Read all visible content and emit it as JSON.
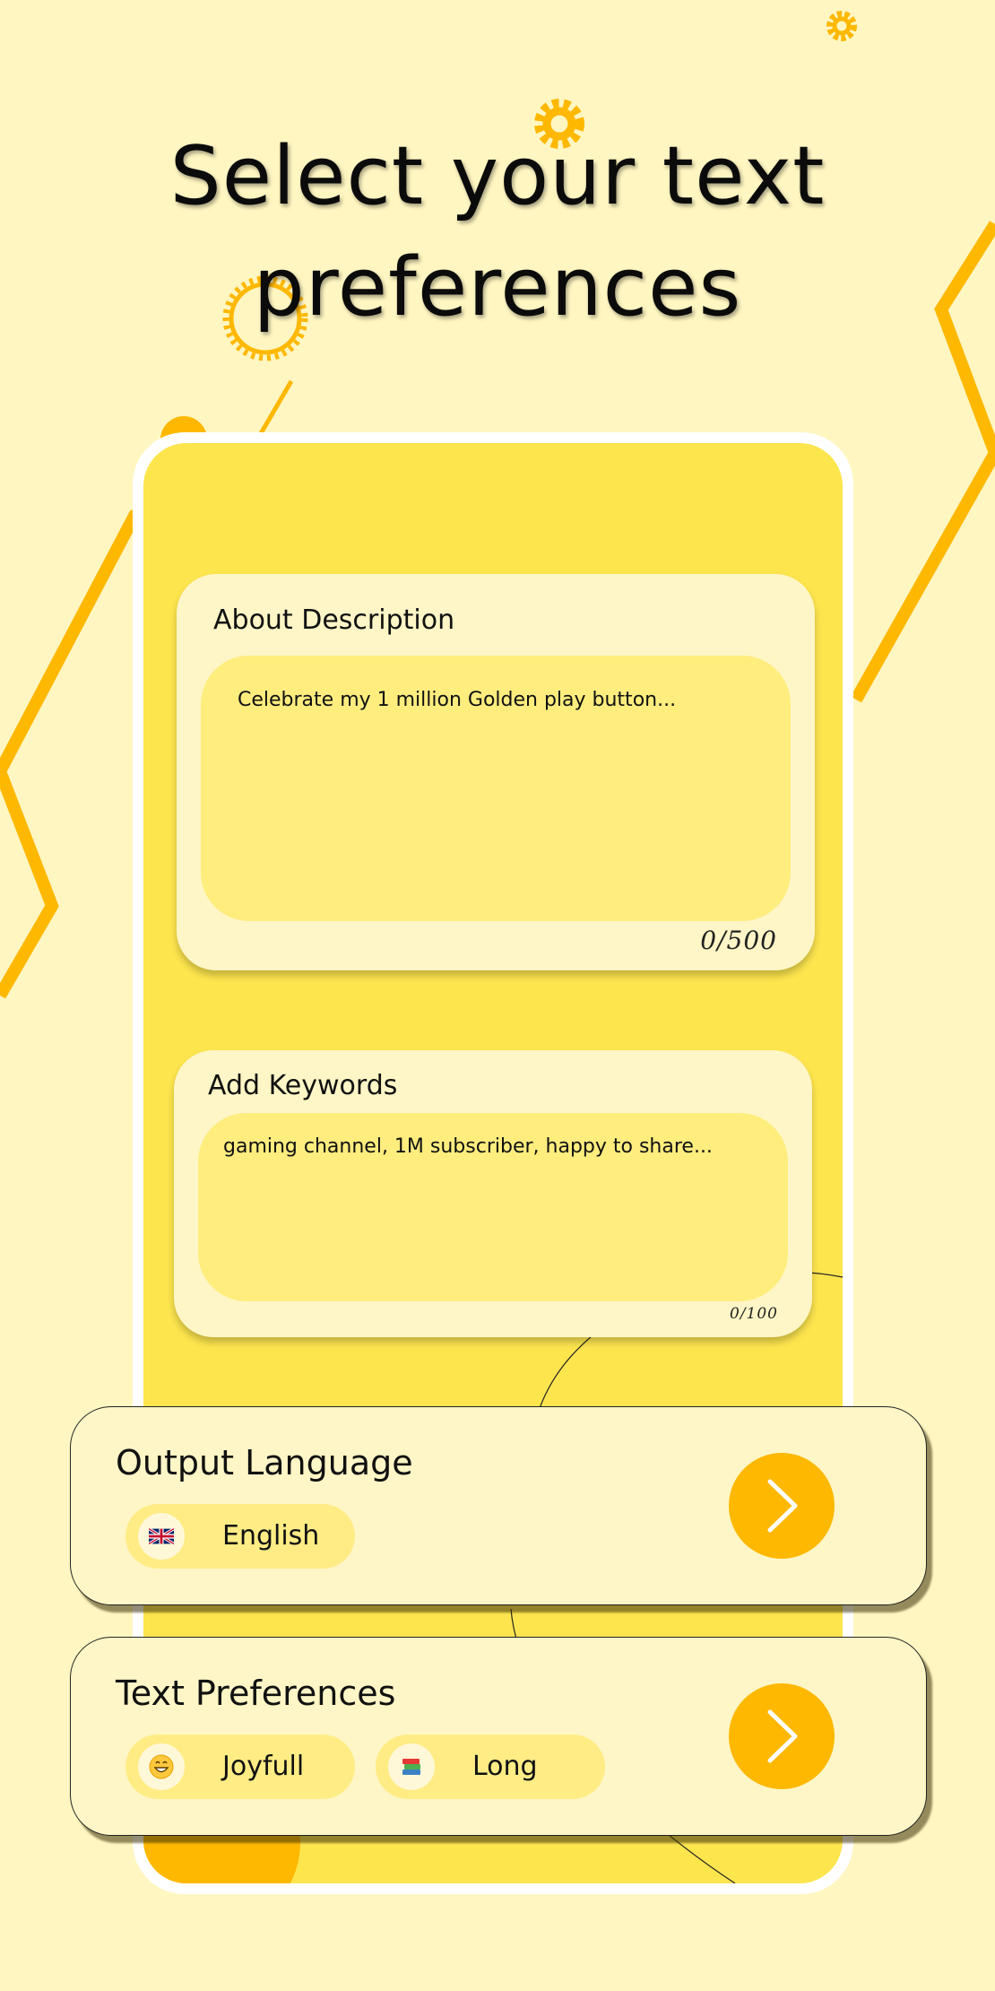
{
  "title": "Select your text preferences",
  "colors": {
    "background": "#FFF6C2",
    "accent": "#FFB800",
    "phone_screen": "#FDE54E",
    "card": "#FEF6C6",
    "input": "#FFED7E"
  },
  "about": {
    "label": "About Description",
    "value": "Celebrate my 1 million Golden play button...",
    "counter": "0/500"
  },
  "keywords": {
    "label": "Add Keywords",
    "value": "gaming channel, 1M subscriber, happy to share...",
    "counter": "0/100"
  },
  "output_language": {
    "title": "Output Language",
    "chip": {
      "icon": "uk-flag-icon",
      "label": "English"
    }
  },
  "text_preferences": {
    "title": "Text Preferences",
    "chips": [
      {
        "icon": "grinning-face-icon",
        "label": "Joyfull"
      },
      {
        "icon": "books-icon",
        "label": "Long"
      }
    ]
  }
}
